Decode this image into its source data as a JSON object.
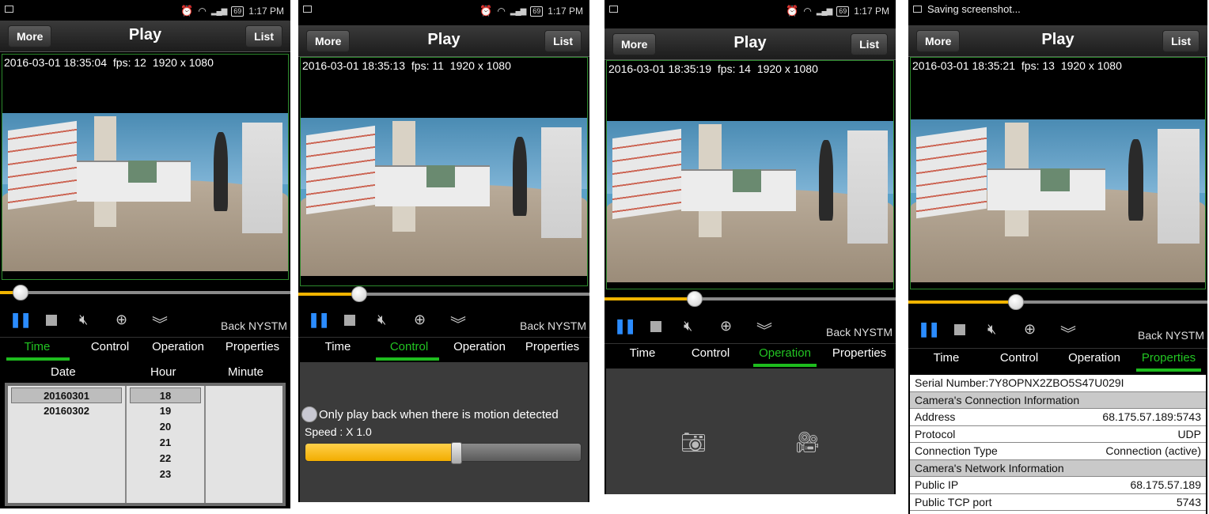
{
  "status_time": "1:17 PM",
  "battery": "69",
  "saving_text": "Saving screenshot...",
  "topbar": {
    "more_label": "More",
    "title": "Play",
    "list_label": "List"
  },
  "back_label": "Back NYSTM",
  "tabs": [
    "Time",
    "Control",
    "Operation",
    "Properties"
  ],
  "screens": [
    {
      "timestamp": "2016-03-01 18:35:04",
      "fps": "fps: 12",
      "resolution": "1920 x 1080",
      "progress": 0.07
    },
    {
      "timestamp": "2016-03-01 18:35:13",
      "fps": "fps: 11",
      "resolution": "1920 x 1080",
      "progress": 0.21
    },
    {
      "timestamp": "2016-03-01 18:35:19",
      "fps": "fps: 14",
      "resolution": "1920 x 1080",
      "progress": 0.31
    },
    {
      "timestamp": "2016-03-01 18:35:21",
      "fps": "fps: 13",
      "resolution": "1920 x 1080",
      "progress": 0.36
    }
  ],
  "time_panel": {
    "headers": [
      "Date",
      "Hour",
      "Minute"
    ],
    "dates": [
      "20160301",
      "20160302"
    ],
    "hours": [
      "18",
      "19",
      "20",
      "21",
      "22",
      "23"
    ]
  },
  "control_panel": {
    "motion_label": "Only play back when there is motion detected",
    "speed_label": "Speed : X 1.0",
    "speed_level": 0.55
  },
  "properties": {
    "serial": "Serial Number:7Y8OPNX2ZBO5S47U029I",
    "section1": "Camera's Connection Information",
    "address_label": "Address",
    "address_value": "68.175.57.189:5743",
    "protocol_label": "Protocol",
    "protocol_value": "UDP",
    "conntype_label": "Connection Type",
    "conntype_value": "Connection (active)",
    "section2": "Camera's Network Information",
    "publicip_label": "Public IP",
    "publicip_value": "68.175.57.189",
    "tcpport_label": "Public TCP port",
    "tcpport_value": "5743"
  }
}
